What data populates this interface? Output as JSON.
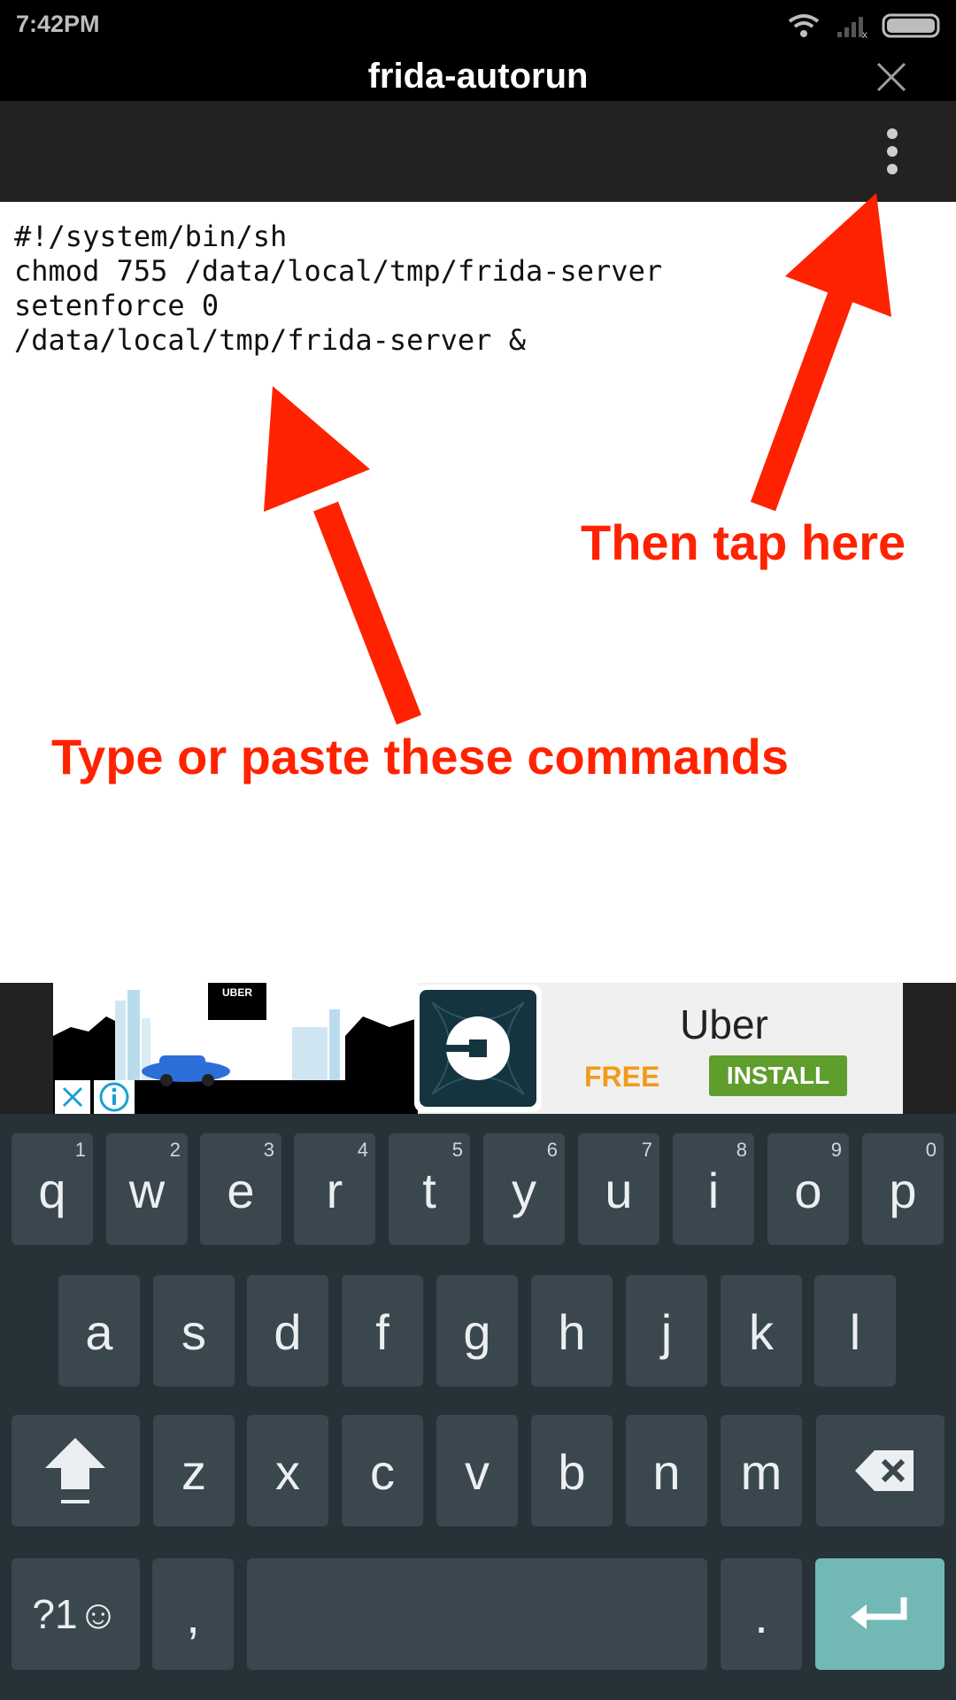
{
  "status_bar": {
    "time": "7:42PM"
  },
  "window": {
    "title": "frida-autorun"
  },
  "editor": {
    "lines": [
      "#!/system/bin/sh",
      "chmod 755 /data/local/tmp/frida-server",
      "setenforce 0",
      "/data/local/tmp/frida-server &"
    ]
  },
  "annotations": {
    "then_tap": "Then tap here",
    "type_paste": "Type or paste these commands",
    "color": "#ff2200"
  },
  "ad": {
    "brand_badge": "UBER",
    "app_name": "Uber",
    "free_label": "FREE",
    "install_label": "INSTALL"
  },
  "keyboard": {
    "row1": [
      {
        "key": "q",
        "hint": "1"
      },
      {
        "key": "w",
        "hint": "2"
      },
      {
        "key": "e",
        "hint": "3"
      },
      {
        "key": "r",
        "hint": "4"
      },
      {
        "key": "t",
        "hint": "5"
      },
      {
        "key": "y",
        "hint": "6"
      },
      {
        "key": "u",
        "hint": "7"
      },
      {
        "key": "i",
        "hint": "8"
      },
      {
        "key": "o",
        "hint": "9"
      },
      {
        "key": "p",
        "hint": "0"
      }
    ],
    "row2": [
      "a",
      "s",
      "d",
      "f",
      "g",
      "h",
      "j",
      "k",
      "l"
    ],
    "row3": [
      "z",
      "x",
      "c",
      "v",
      "b",
      "n",
      "m"
    ],
    "symbols_label": "?1☺",
    "comma": ",",
    "period": "."
  },
  "colors": {
    "accent_enter": "#72b8b4",
    "keyboard_bg": "#263238",
    "key_bg": "#3b474e"
  }
}
